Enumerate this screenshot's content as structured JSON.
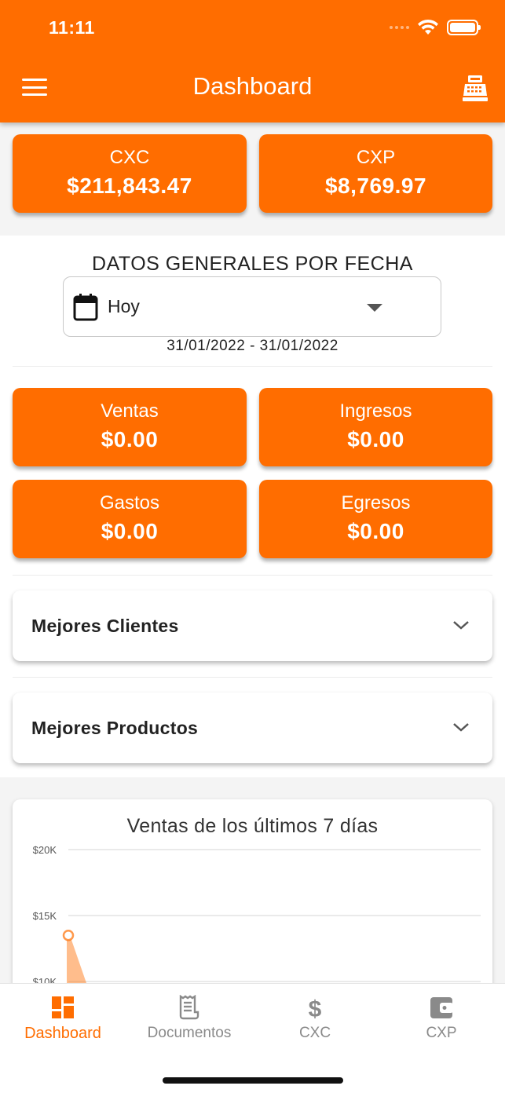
{
  "status": {
    "time": "11:11"
  },
  "appbar": {
    "title": "Dashboard"
  },
  "summary": [
    {
      "label": "CXC",
      "value": "$211,843.47"
    },
    {
      "label": "CXP",
      "value": "$8,769.97"
    }
  ],
  "general": {
    "title": "DATOS GENERALES POR FECHA",
    "period_selected": "Hoy",
    "date_range": "31/01/2022 - 31/01/2022"
  },
  "metrics": [
    {
      "label": "Ventas",
      "value": "$0.00"
    },
    {
      "label": "Ingresos",
      "value": "$0.00"
    },
    {
      "label": "Gastos",
      "value": "$0.00"
    },
    {
      "label": "Egresos",
      "value": "$0.00"
    }
  ],
  "sections": {
    "best_clients": "Mejores Clientes",
    "best_products": "Mejores Productos"
  },
  "chart_data": {
    "type": "area",
    "title": "Ventas de los últimos 7 días",
    "y_ticks": [
      "$20K",
      "$15K",
      "$10K"
    ],
    "y_tick_values": [
      20000,
      15000,
      10000
    ],
    "x": [],
    "values": [
      13500
    ],
    "ylim": [
      10000,
      20000
    ],
    "grid": true,
    "color": "#ff6d00"
  },
  "nav": [
    {
      "label": "Dashboard",
      "icon": "dashboard-icon",
      "active": true
    },
    {
      "label": "Documentos",
      "icon": "receipt-icon",
      "active": false
    },
    {
      "label": "CXC",
      "icon": "dollar-icon",
      "active": false
    },
    {
      "label": "CXP",
      "icon": "wallet-icon",
      "active": false
    }
  ],
  "colors": {
    "accent": "#ff6d00",
    "inactive": "#8a8a8a"
  }
}
